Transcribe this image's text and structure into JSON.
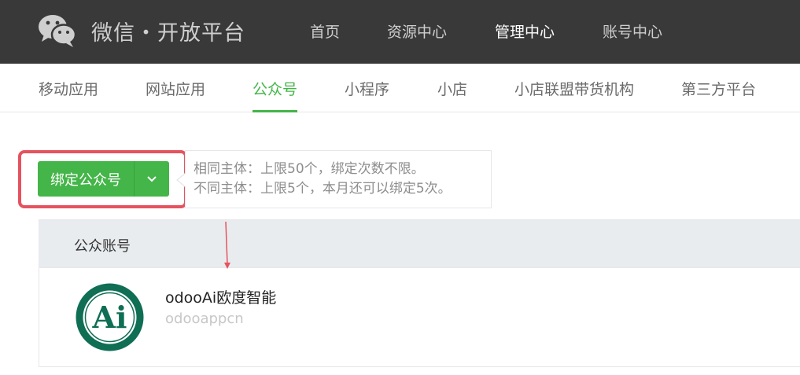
{
  "brand": {
    "title": "微信・开放平台",
    "logo_icon": "wechat-logo-icon"
  },
  "topnav": {
    "items": [
      {
        "label": "首页",
        "active": false
      },
      {
        "label": "资源中心",
        "active": false
      },
      {
        "label": "管理中心",
        "active": true
      },
      {
        "label": "账号中心",
        "active": false
      }
    ]
  },
  "subnav": {
    "tabs": [
      {
        "label": "移动应用",
        "active": false
      },
      {
        "label": "网站应用",
        "active": false
      },
      {
        "label": "公众号",
        "active": true
      },
      {
        "label": "小程序",
        "active": false
      },
      {
        "label": "小店",
        "active": false
      },
      {
        "label": "小店联盟带货机构",
        "active": false
      },
      {
        "label": "第三方平台",
        "active": false
      }
    ]
  },
  "bind": {
    "label": "绑定公众号",
    "dropdown_icon": "chevron-down-icon"
  },
  "tip": {
    "line1": "相同主体：上限50个，绑定次数不限。",
    "line2": "不同主体：上限5个，本月还可以绑定5次。"
  },
  "table": {
    "header": "公众账号",
    "rows": [
      {
        "name": "odooAi欧度智能",
        "id": "odooappcn",
        "avatar_text": "Ai"
      }
    ]
  },
  "colors": {
    "topbar": "#393939",
    "accent": "#44b549",
    "highlight": "#e5535f"
  }
}
